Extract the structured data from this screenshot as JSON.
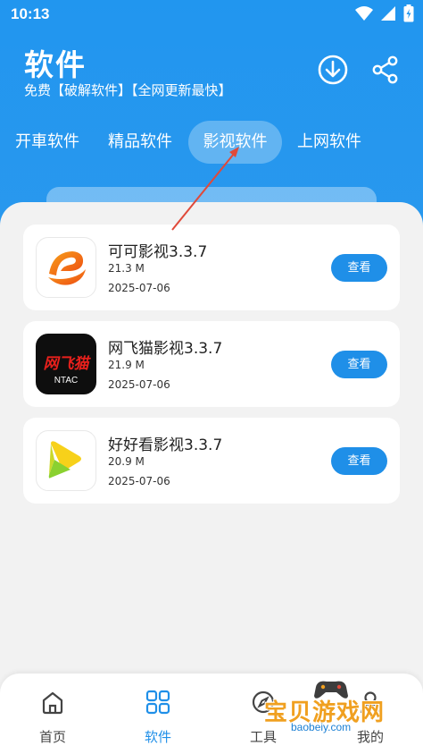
{
  "status_bar": {
    "time": "10:13"
  },
  "header": {
    "title": "软件",
    "subtitle": "免费【破解软件】【全网更新最快】"
  },
  "tabs": [
    {
      "label": "开車软件",
      "active": false
    },
    {
      "label": "精品软件",
      "active": false
    },
    {
      "label": "影视软件",
      "active": true
    },
    {
      "label": "上网软件",
      "active": false
    }
  ],
  "apps": [
    {
      "name": "可可影视3.3.7",
      "size": "21.3 M",
      "date": "2025-07-06",
      "button": "查看",
      "icon": "keke-icon"
    },
    {
      "name": "网飞猫影视3.3.7",
      "size": "21.9 M",
      "date": "2025-07-06",
      "button": "查看",
      "icon": "wangfeimao-icon"
    },
    {
      "name": "好好看影视3.3.7",
      "size": "20.9 M",
      "date": "2025-07-06",
      "button": "查看",
      "icon": "haohaokan-icon"
    }
  ],
  "icon_texts": {
    "wangfeimao_logo": "网飞猫",
    "wangfeimao_sub": "NTAC"
  },
  "bottom_nav": [
    {
      "label": "首页",
      "icon": "home-icon",
      "active": false
    },
    {
      "label": "软件",
      "icon": "apps-grid-icon",
      "active": true
    },
    {
      "label": "工具",
      "icon": "compass-icon",
      "active": false
    },
    {
      "label": "我的",
      "icon": "user-icon",
      "active": false
    }
  ],
  "watermark": {
    "text": "宝贝游戏网",
    "url": "baobeiy.com"
  },
  "colors": {
    "primary": "#1f8fe8",
    "header_bg": "#2196ef",
    "background": "#f2f2f2",
    "annotation_arrow": "#e04a3a"
  }
}
